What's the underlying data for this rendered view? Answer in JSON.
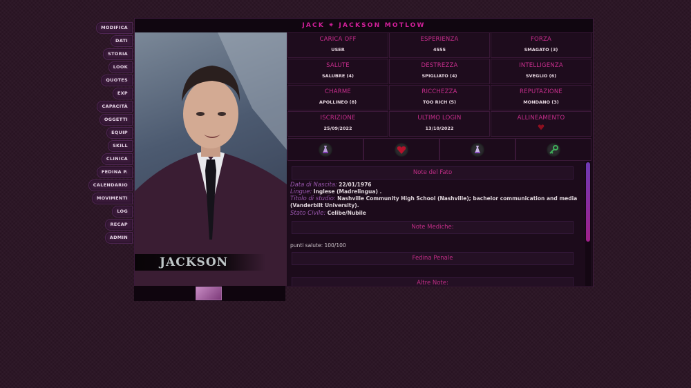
{
  "menu": [
    "MODIFICA",
    "DATI",
    "STORIA",
    "LOOK",
    "QUOTES",
    "EXP",
    "CAPACITÀ",
    "OGGETTI",
    "EQUIP",
    "SKILL",
    "CLINICA",
    "FEDINA P.",
    "CALENDARIO",
    "MOVIMENTI",
    "LOG",
    "RECAP",
    "ADMIN"
  ],
  "title": "JACK ✷ JACKSON MOTLOW",
  "photo": {
    "name": "JACKSON"
  },
  "stats": [
    {
      "label": "CARICA OFF",
      "value": "USER"
    },
    {
      "label": "ESPERIENZA",
      "value": "4555"
    },
    {
      "label": "FORZA",
      "value": "SMAGATO (3)"
    },
    {
      "label": "SALUTE",
      "value": "SALUBRE (4)"
    },
    {
      "label": "DESTREZZA",
      "value": "SPIGLIATO (4)"
    },
    {
      "label": "INTELLIGENZA",
      "value": "SVEGLIO (6)"
    },
    {
      "label": "CHARME",
      "value": "APOLLINEO (8)"
    },
    {
      "label": "RICCHEZZA",
      "value": "TOO RICH (5)"
    },
    {
      "label": "REPUTAZIONE",
      "value": "MONDANO (3)"
    },
    {
      "label": "ISCRIZIONE",
      "value": "25/09/2022"
    },
    {
      "label": "ULTIMO LOGIN",
      "value": "13/10/2022"
    },
    {
      "label": "ALLINEAMENTO",
      "value": ""
    }
  ],
  "icons": [
    "potion-icon",
    "heart-icon",
    "potion-icon",
    "key-icon"
  ],
  "notes": {
    "fato_head": "Note del Fato",
    "nascita_label": "Data di Nascita:",
    "nascita": "22/01/1976",
    "lingue_label": "Lingue:",
    "lingue": "Inglese (Madrelingua) .",
    "studio_label": "Titolo di studio:",
    "studio": "Nashville Community High School (Nashville); bachelor communication and media (Vanderbilt University).",
    "civile_label": "Stato Civile:",
    "civile": "Celibe/Nubile",
    "mediche_head": "Note Mediche:",
    "salute_line": "punti salute: 100/100",
    "fedina_head": "Fedina Penale",
    "altre_head": "Altre Note:"
  },
  "colors": {
    "accent": "#c92e8e",
    "background": "#2a1424"
  }
}
